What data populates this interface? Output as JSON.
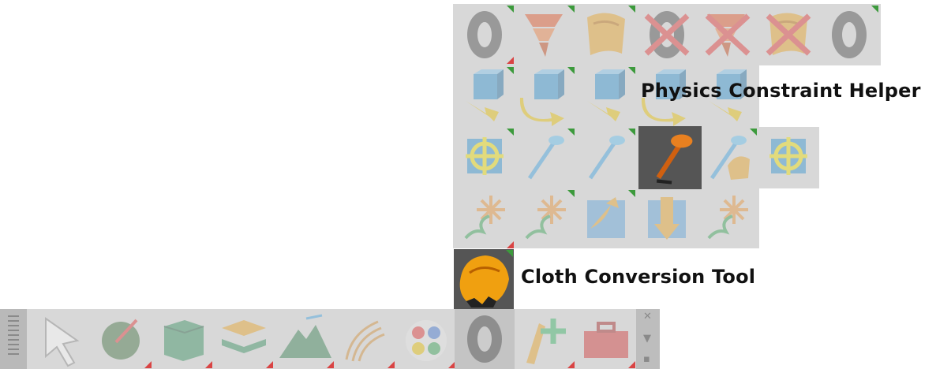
{
  "tooltips": {
    "physics_constraint": "Physics Constraint Helper",
    "cloth_conversion": "Cloth Conversion Tool"
  },
  "popup_rows": [
    [
      "tire-icon",
      "tornado-icon",
      "cloth-icon",
      "tire-cross-icon",
      "tornado-cross-icon",
      "cloth-cross-icon",
      "tire-icon"
    ],
    [
      "cube-down-arrow-icon",
      "cube-rotate-arrow-icon",
      "cube-orange-arrow-icon",
      "cube-curve-arrow-icon",
      "cube-down-arrow-icon"
    ],
    [
      "cube-crosshair-icon",
      "pin-1-icon",
      "pin-2-icon",
      "nail-icon",
      "pin-hand-icon",
      "cube-crosshair-icon"
    ],
    [
      "flower-spring-icon",
      "flower-spring-icon",
      "cloth-patch-arrow-icon",
      "cloth-patch-down-icon",
      "flower-spring-icon"
    ]
  ],
  "selected": "nail-icon",
  "shelf_tools": [
    "arrow-select-icon",
    "sphere-pen-icon",
    "cube-green-icon",
    "layers-icon",
    "mountain-icon",
    "hair-icon",
    "color-palette-icon",
    "tire-icon",
    "pencil-plus-icon",
    "toolbox-icon"
  ],
  "cloth_button": "cloth-conversion-icon",
  "colors": {
    "panel": "#d8d8d8",
    "accent_green": "#3c9a3c",
    "accent_red": "#d94444",
    "selected_bg": "#555555"
  }
}
